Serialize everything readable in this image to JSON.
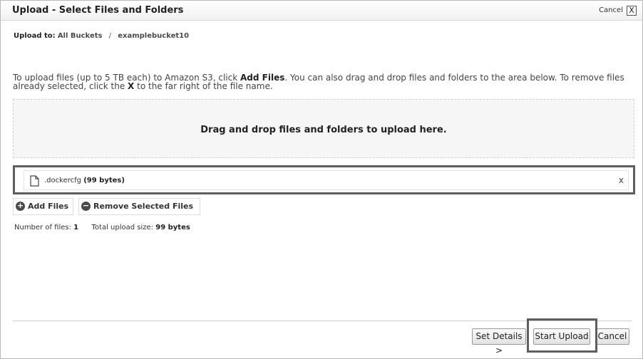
{
  "dialog": {
    "title": "Upload - Select Files and Folders",
    "cancel_label": "Cancel",
    "close_glyph": "X"
  },
  "breadcrumb": {
    "label": "Upload to:",
    "root": "All Buckets",
    "separator": "/",
    "bucket": "examplebucket10"
  },
  "instructions": {
    "part1": "To upload files (up to 5 TB each) to Amazon S3, click ",
    "add_files": "Add Files",
    "part2": ". You can also drag and drop files and folders to the area below. To remove files already selected, click the ",
    "x": "X",
    "part3": " to the far right of the file name."
  },
  "dropzone": {
    "text": "Drag and drop files and folders to upload here."
  },
  "files": [
    {
      "name": ".dockercfg",
      "size": "(99 bytes)",
      "icon": "file-icon",
      "remove": "x"
    }
  ],
  "actions": {
    "add_files": "Add Files",
    "add_icon": "plus-circle-icon",
    "remove_selected": "Remove Selected Files",
    "remove_icon": "minus-circle-icon"
  },
  "summary": {
    "count_label": "Number of files:",
    "count": "1",
    "size_label": "Total upload size:",
    "size": "99 bytes"
  },
  "footer": {
    "set_details": "Set Details >",
    "start_upload": "Start Upload",
    "cancel": "Cancel"
  }
}
